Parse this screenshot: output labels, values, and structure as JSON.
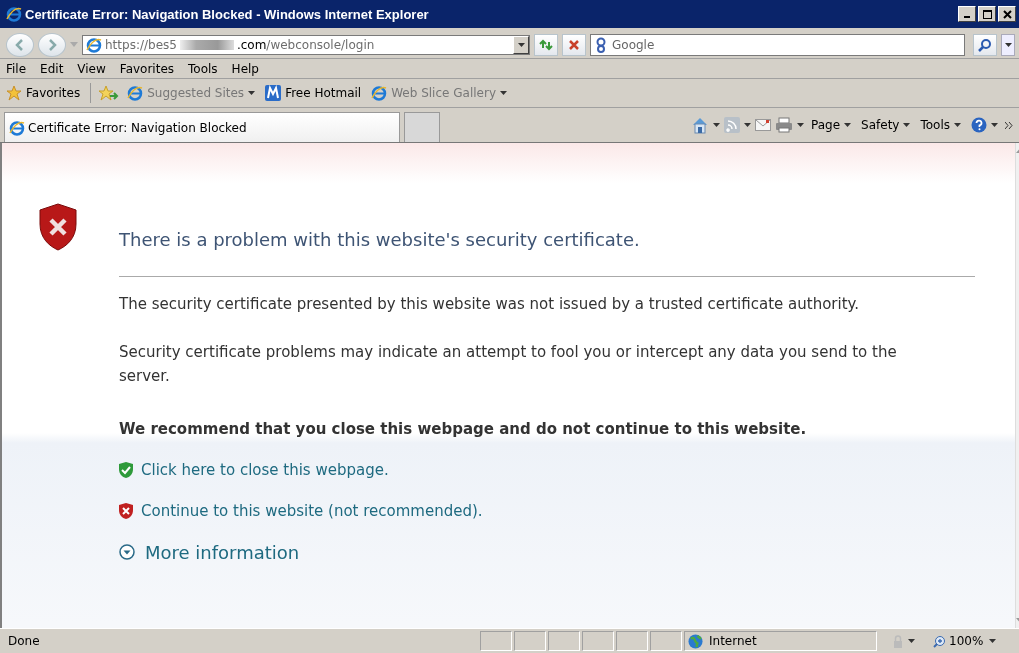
{
  "window": {
    "title": "Certificate Error: Navigation Blocked - Windows Internet Explorer"
  },
  "address_bar": {
    "url_start": "https://bes5",
    "url_host_end": ".com",
    "url_path": "/webconsole/login"
  },
  "search": {
    "placeholder": "Google"
  },
  "menu": [
    "File",
    "Edit",
    "View",
    "Favorites",
    "Tools",
    "Help"
  ],
  "favorites_bar": {
    "label": "Favorites",
    "items": [
      {
        "kind": "ie",
        "label": "Suggested Sites",
        "dropdown": true,
        "disabled": true
      },
      {
        "kind": "hotmail",
        "label": "Free Hotmail",
        "dropdown": false,
        "disabled": false
      },
      {
        "kind": "ie",
        "label": "Web Slice Gallery",
        "dropdown": true,
        "disabled": true
      }
    ]
  },
  "tabs": [
    {
      "label": "Certificate Error: Navigation Blocked",
      "selected": true
    }
  ],
  "command_bar": [
    "Page",
    "Safety",
    "Tools"
  ],
  "content": {
    "heading": "There is a problem with this website's security certificate.",
    "paragraphs": [
      "The security certificate presented by this website was not issued by a trusted certificate authority.",
      "Security certificate problems may indicate an attempt to fool you or intercept any data you send to the server."
    ],
    "recommendation": "We recommend that you close this webpage and do not continue to this website.",
    "links": [
      {
        "kind": "close",
        "text": "Click here to close this webpage."
      },
      {
        "kind": "continue",
        "text": "Continue to this website (not recommended)."
      },
      {
        "kind": "more",
        "text": "More information"
      }
    ]
  },
  "status_bar": {
    "text": "Done",
    "zone": "Internet",
    "zoom": "100%"
  }
}
